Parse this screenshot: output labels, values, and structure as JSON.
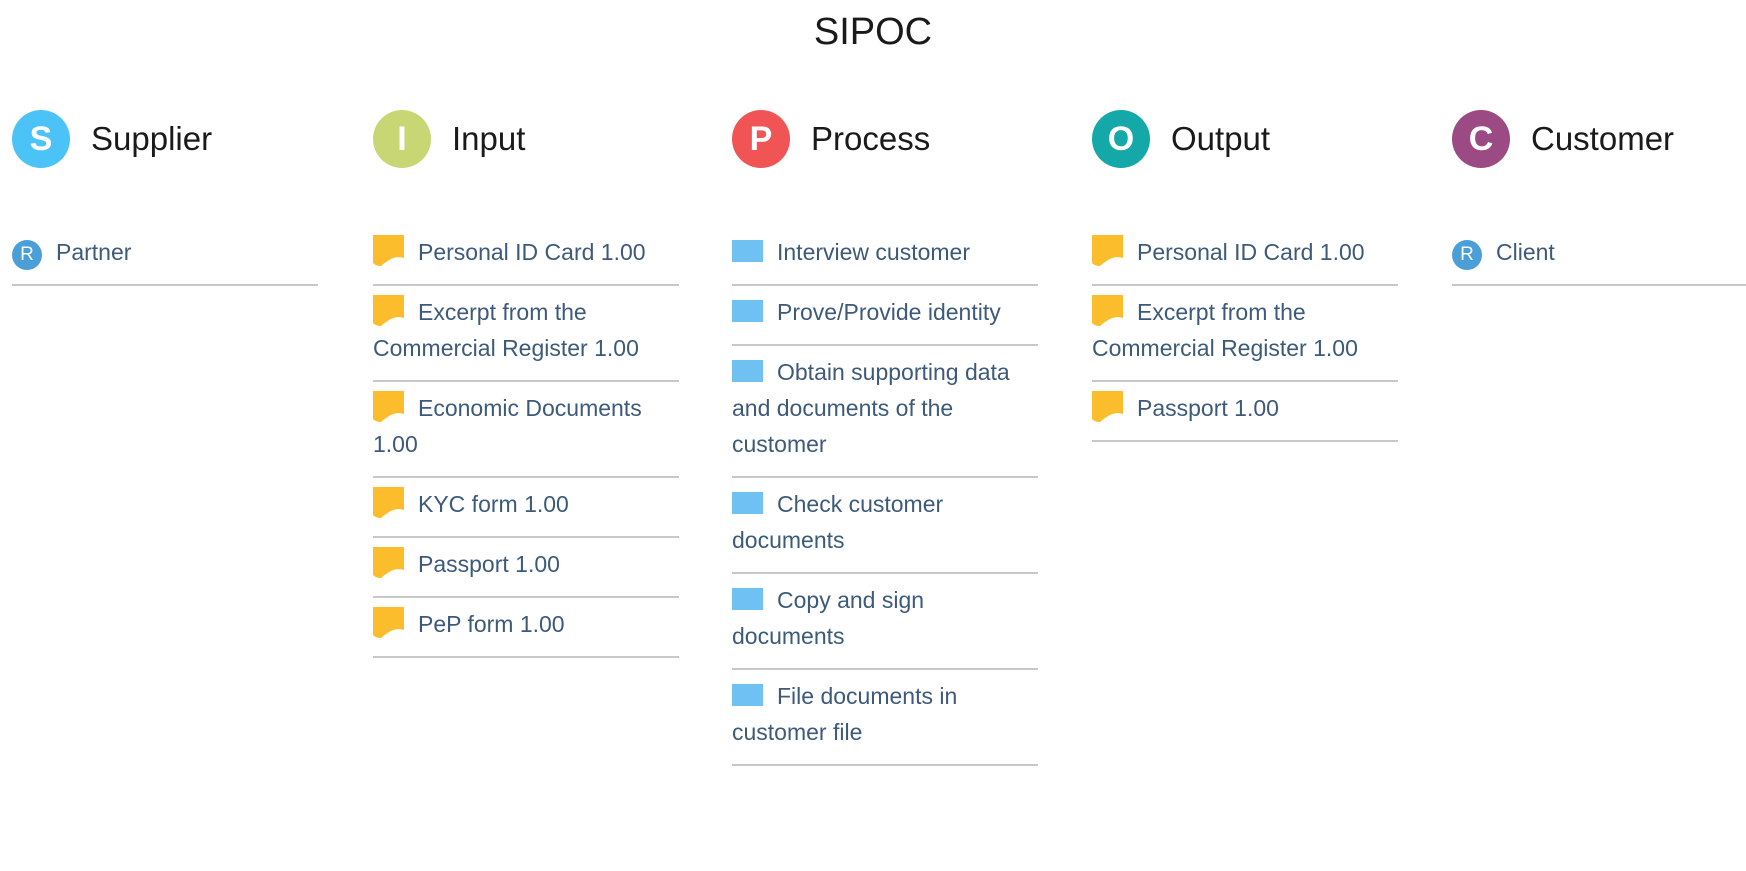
{
  "title": "SIPOC",
  "colors": {
    "supplier": "#4cc3f7",
    "input": "#c8d773",
    "process": "#f05454",
    "output": "#15a8a8",
    "customer": "#9c4a84",
    "document_icon": "#fbbd2b",
    "process_icon": "#6ec1f0",
    "role_icon": "#4a9fd8"
  },
  "columns": [
    {
      "letter": "S",
      "label": "Supplier",
      "color": "#4cc3f7",
      "items": [
        {
          "icon": "role-icon",
          "glyph": "R",
          "text": "Partner"
        }
      ]
    },
    {
      "letter": "I",
      "label": "Input",
      "color": "#c8d773",
      "items": [
        {
          "icon": "document-icon",
          "text": "Personal ID Card 1.00"
        },
        {
          "icon": "document-icon",
          "text": "Excerpt from the Commercial Register 1.00"
        },
        {
          "icon": "document-icon",
          "text": "Economic Documents 1.00"
        },
        {
          "icon": "document-icon",
          "text": "KYC form 1.00"
        },
        {
          "icon": "document-icon",
          "text": "Passport 1.00"
        },
        {
          "icon": "document-icon",
          "text": "PeP form 1.00"
        }
      ]
    },
    {
      "letter": "P",
      "label": "Process",
      "color": "#f05454",
      "items": [
        {
          "icon": "process-step-icon",
          "text": "Interview customer"
        },
        {
          "icon": "process-step-icon",
          "text": "Prove/Provide identity"
        },
        {
          "icon": "process-step-icon",
          "text": "Obtain supporting data and documents of the customer"
        },
        {
          "icon": "process-step-icon",
          "text": "Check customer documents"
        },
        {
          "icon": "process-step-icon",
          "text": "Copy and sign documents"
        },
        {
          "icon": "process-step-icon",
          "text": "File documents in customer file"
        }
      ]
    },
    {
      "letter": "O",
      "label": "Output",
      "color": "#15a8a8",
      "items": [
        {
          "icon": "document-icon",
          "text": "Personal ID Card 1.00"
        },
        {
          "icon": "document-icon",
          "text": "Excerpt from the Commercial Register 1.00"
        },
        {
          "icon": "document-icon",
          "text": "Passport 1.00"
        }
      ]
    },
    {
      "letter": "C",
      "label": "Customer",
      "color": "#9c4a84",
      "items": [
        {
          "icon": "role-icon",
          "glyph": "R",
          "text": "Client"
        }
      ]
    }
  ]
}
